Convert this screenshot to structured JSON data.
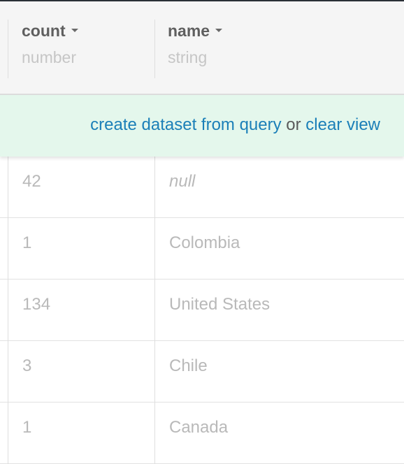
{
  "columns": [
    {
      "name": "count",
      "type": "number"
    },
    {
      "name": "name",
      "type": "string"
    }
  ],
  "banner": {
    "create_label": "create dataset from query",
    "or_label": "or",
    "clear_label": "clear view"
  },
  "rows": [
    {
      "count": "42",
      "name": "null"
    },
    {
      "count": "1",
      "name": "Colombia"
    },
    {
      "count": "134",
      "name": "United States"
    },
    {
      "count": "3",
      "name": "Chile"
    },
    {
      "count": "1",
      "name": "Canada"
    }
  ]
}
